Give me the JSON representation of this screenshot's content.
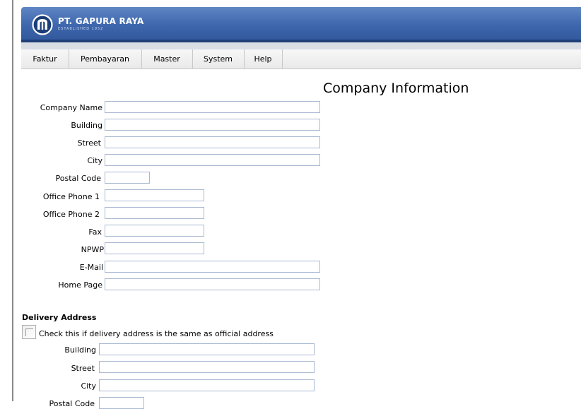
{
  "header": {
    "brand": "PT. GAPURA RAYA",
    "tagline": "ESTABLISHED 1952",
    "logo_icon": "gapura-logo-icon",
    "colors": {
      "banner": "#3e67ad",
      "banner_dark": "#1e3f78"
    }
  },
  "menu": {
    "items": [
      {
        "label": "Faktur"
      },
      {
        "label": "Pembayaran"
      },
      {
        "label": "Master"
      },
      {
        "label": "System"
      },
      {
        "label": "Help"
      }
    ]
  },
  "company": {
    "title": "Company Information",
    "fields": {
      "company_name": {
        "label": "Company Name",
        "value": ""
      },
      "building": {
        "label": "Building",
        "value": ""
      },
      "street": {
        "label": "Street",
        "value": ""
      },
      "city": {
        "label": "City",
        "value": ""
      },
      "postal_code": {
        "label": "Postal Code",
        "value": ""
      },
      "office_phone_1": {
        "label": "Office Phone 1",
        "value": ""
      },
      "office_phone_2": {
        "label": "Office Phone 2",
        "value": ""
      },
      "fax": {
        "label": "Fax",
        "value": ""
      },
      "npwp": {
        "label": "NPWP",
        "value": ""
      },
      "email": {
        "label": "E-Mail",
        "value": ""
      },
      "home_page": {
        "label": "Home Page",
        "value": ""
      }
    }
  },
  "delivery": {
    "heading": "Delivery Address",
    "same_as_official": {
      "label": "Check this if delivery address is the same as official address",
      "checked": false
    },
    "fields": {
      "building": {
        "label": "Building",
        "value": ""
      },
      "street": {
        "label": "Street",
        "value": ""
      },
      "city": {
        "label": "City",
        "value": ""
      },
      "postal_code": {
        "label": "Postal Code",
        "value": ""
      }
    }
  }
}
